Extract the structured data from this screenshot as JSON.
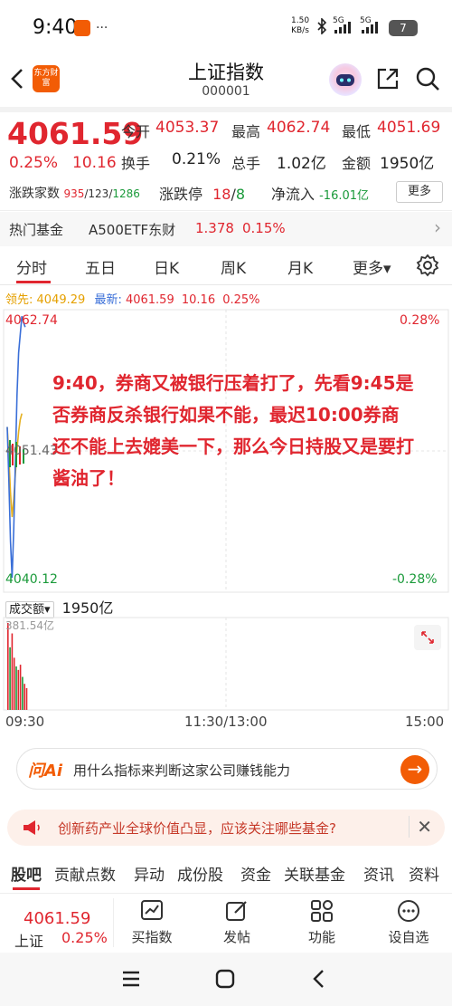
{
  "status_bar": {
    "time": "9:40",
    "net_rate_value": "1.50",
    "net_rate_unit": "KB/s",
    "signal1": "5G",
    "signal2": "5G",
    "battery": "7"
  },
  "header": {
    "logo_text": "东方财富",
    "title": "上证指数",
    "code": "000001"
  },
  "quote": {
    "price": "4061.59",
    "change_pct": "0.25%",
    "change_abs": "10.16",
    "open_label": "今开",
    "open": "4053.37",
    "high_label": "最高",
    "high": "4062.74",
    "low_label": "最低",
    "low": "4051.69",
    "turnover_label": "换手",
    "turnover": "0.21%",
    "volume_label": "总手",
    "volume": "1.02亿",
    "amount_label": "金额",
    "amount": "1950亿",
    "breadth_label": "涨跌家数",
    "breadth_up": "935",
    "breadth_sep1": "/",
    "breadth_flat": "123",
    "breadth_sep2": "/",
    "breadth_down": "1286",
    "limit_label": "涨跌停",
    "limit_up": "18",
    "limit_sep": "/",
    "limit_down": "8",
    "netflow_label": "净流入",
    "netflow": "-16.01亿",
    "more": "更多"
  },
  "hot_fund": {
    "label": "热门基金",
    "name": "A500ETF东财",
    "price": "1.378",
    "pct": "0.15%",
    "chevron": "›"
  },
  "tabs": [
    {
      "label": "分时"
    },
    {
      "label": "五日"
    },
    {
      "label": "日K"
    },
    {
      "label": "周K"
    },
    {
      "label": "月K"
    },
    {
      "label": "更多▾"
    }
  ],
  "info_line": {
    "lead_label": "领先:",
    "lead_value": "4049.29",
    "latest_label": "最新:",
    "latest_value": "4061.59",
    "latest_abs": "10.16",
    "latest_pct": "0.25%"
  },
  "chart_data": {
    "type": "line",
    "y_max_label": "4062.74",
    "y_mid_label": "4051.43",
    "y_min_label": "4040.12",
    "pct_max_label": "0.28%",
    "pct_min_label": "-0.28%",
    "ylim": [
      4040.12,
      4062.74
    ],
    "x_labels": [
      "09:30",
      "11:30/13:00",
      "15:00"
    ],
    "series": [
      {
        "values": [
          4053.4,
          4049.0,
          4044.0,
          4041.0,
          4045.0,
          4050.5,
          4056.0,
          4059.5,
          4061.0,
          4062.5,
          4062.0,
          4061.6
        ]
      },
      {
        "values": [
          4053.4,
          4051.0,
          4048.0,
          4046.0,
          4047.5,
          4049.5,
          4051.5,
          4053.0,
          4054.0,
          4054.5
        ]
      }
    ]
  },
  "annotation": "9:40，券商又被银行压着打了，先看9:45是否券商反杀银行如果不能，最迟10:00券商还不能上去媲美一下，那么今日持股又是要打酱油了！",
  "volume": {
    "select_label": "成交额",
    "select_arrow": "▾",
    "total": "1950亿",
    "max_label": "381.54亿",
    "bars": [
      100,
      72,
      88,
      60,
      50,
      46,
      52,
      38,
      30,
      25
    ]
  },
  "ai_bar": {
    "logo": "问Ai",
    "text": "用什么指标来判断这家公司赚钱能力",
    "go": "→"
  },
  "promo": {
    "text": "创新药产业全球价值凸显，应该关注哪些基金?",
    "close": "✕"
  },
  "bottom_tabs": [
    {
      "label": "股吧"
    },
    {
      "label": "贡献点数"
    },
    {
      "label": "异动"
    },
    {
      "label": "成份股"
    },
    {
      "label": "资金"
    },
    {
      "label": "关联基金"
    },
    {
      "label": "资讯"
    },
    {
      "label": "资料"
    }
  ],
  "toolbar": {
    "quote_price": "4061.59",
    "quote_name": "上证",
    "quote_pct": "0.25%",
    "buy_label": "买指数",
    "post_label": "发帖",
    "func_label": "功能",
    "watch_label": "设自选"
  },
  "colors": {
    "up": "#e0262f",
    "down": "#1a9a3a",
    "brand": "#f25c05",
    "price_line": "#3a6fd8",
    "avg_line": "#e5b020"
  }
}
